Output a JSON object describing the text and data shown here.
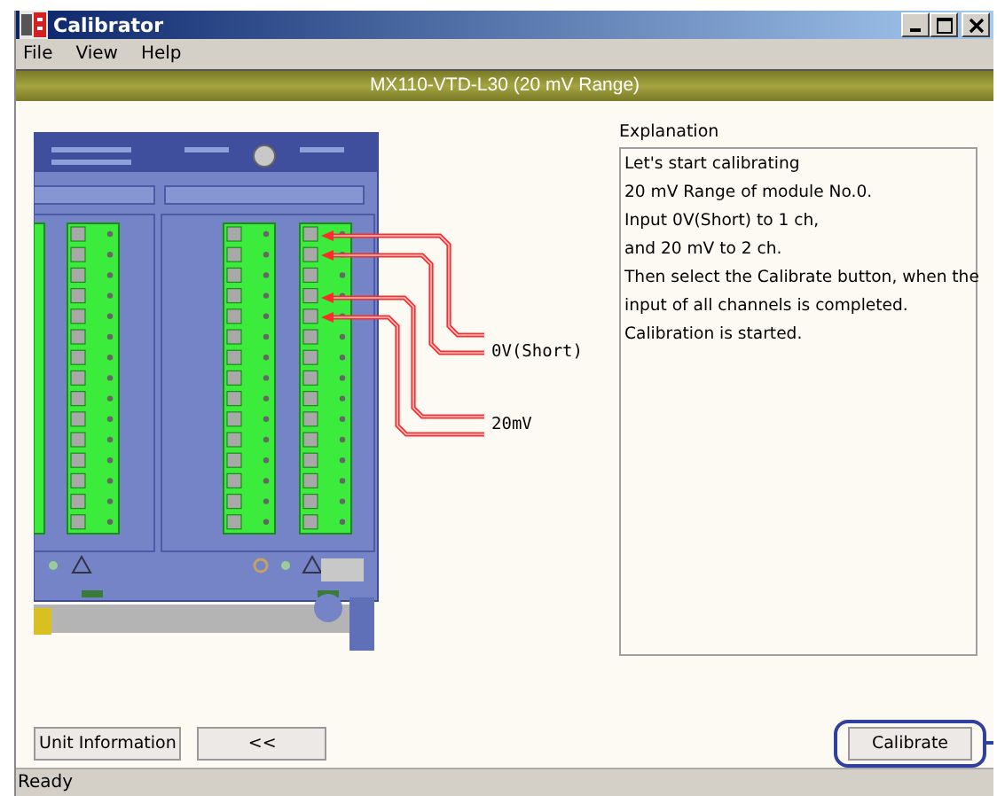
{
  "window": {
    "title": "Calibrator"
  },
  "menu": [
    "File",
    "View",
    "Help"
  ],
  "header": "MX110-VTD-L30 (20 mV Range)",
  "diagram": {
    "labels": [
      "0V(Short)",
      "20mV"
    ]
  },
  "explanation": {
    "title": "Explanation",
    "lines": [
      "Let's start calibrating",
      "20 mV Range of module No.0.",
      "Input 0V(Short) to 1 ch,",
      "and 20 mV to 2 ch.",
      "Then select the Calibrate button, when the",
      "input of all channels is completed.",
      "Calibration is started."
    ]
  },
  "buttons": [
    {
      "label": "Unit Information",
      "highlighted": false
    },
    {
      "label": "<<",
      "highlighted": false
    },
    {
      "label": "Calibrate",
      "highlighted": true
    }
  ],
  "status_bar": "Ready"
}
